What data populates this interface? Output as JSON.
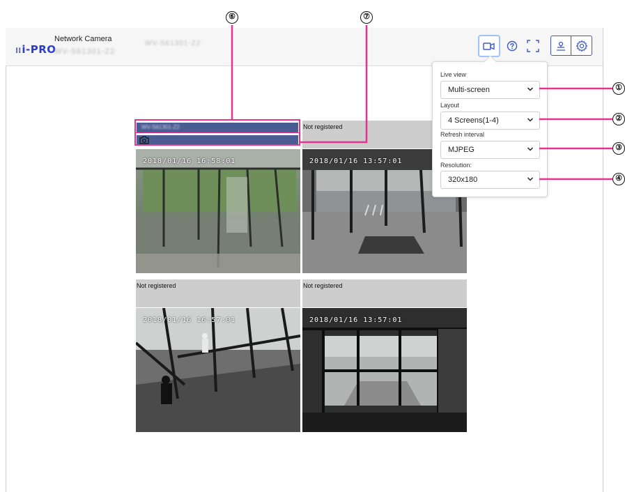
{
  "header": {
    "logo": "i-PRO",
    "product_label": "Network Camera",
    "model": "WV-S61301-Z2",
    "camera_title": "WV-S61301-Z2"
  },
  "icons": {
    "live": "video-camera-icon",
    "help": "help-circle-icon",
    "fullscreen": "fullscreen-icon",
    "user": "user-icon",
    "settings": "gear-icon"
  },
  "panel": {
    "live_view": {
      "label": "Live view",
      "value": "Multi-screen"
    },
    "layout": {
      "label": "Layout",
      "value": "4 Screens(1-4)"
    },
    "refresh": {
      "label": "Refresh interval",
      "value": "MJPEG"
    },
    "resolution": {
      "label": "Resolution:",
      "value": "320x180"
    }
  },
  "cells": [
    {
      "title": "WV-S61301-Z2",
      "timestamp": "2018/01/16 16:58:01"
    },
    {
      "title": "Not registered",
      "timestamp": "2018/01/16 13:57:01"
    },
    {
      "title": "Not registered",
      "timestamp": "2018/01/16 16:57:01"
    },
    {
      "title": "Not registered",
      "timestamp": "2018/01/16 13:57:01"
    }
  ],
  "callouts": [
    "①",
    "②",
    "③",
    "④",
    "⑥",
    "⑦"
  ],
  "colors": {
    "brand": "#2c3ec4",
    "highlight": "#e6338c",
    "title_bar": "#4b5c93",
    "accent_border": "#9fc2ff"
  }
}
